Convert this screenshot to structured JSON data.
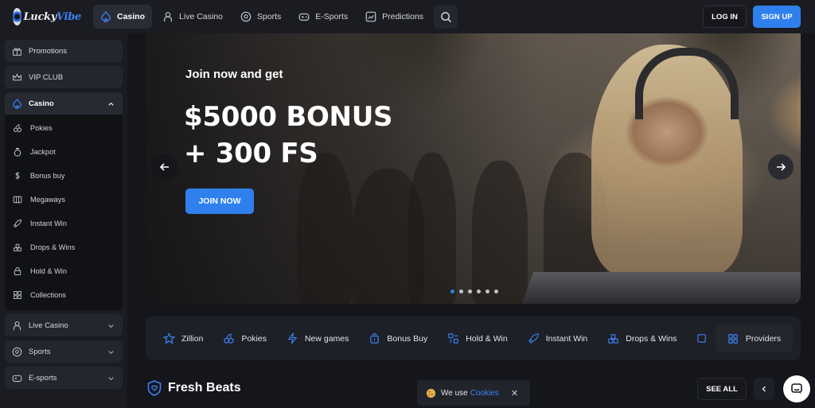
{
  "brand": {
    "logo_part1": "Lucky",
    "logo_part2": "Vibe"
  },
  "nav": {
    "items": [
      {
        "label": "Casino",
        "icon": "spade-icon",
        "active": true
      },
      {
        "label": "Live Casino",
        "icon": "dealer-icon"
      },
      {
        "label": "Sports",
        "icon": "soccer-ball-icon"
      },
      {
        "label": "E-Sports",
        "icon": "gamepad-icon"
      },
      {
        "label": "Predictions",
        "icon": "chart-icon"
      }
    ],
    "search_icon": "search-icon"
  },
  "auth": {
    "login_label": "LOG IN",
    "signup_label": "SIGN UP"
  },
  "sidebar": {
    "top_items": [
      {
        "label": "Promotions",
        "icon": "gift-icon"
      },
      {
        "label": "VIP CLUB",
        "icon": "crown-icon"
      }
    ],
    "casino": {
      "label": "Casino",
      "icon": "spade-icon",
      "expanded": true,
      "sub_items": [
        {
          "label": "Pokies",
          "icon": "cherry-icon"
        },
        {
          "label": "Jackpot",
          "icon": "money-bag-icon"
        },
        {
          "label": "Bonus buy",
          "icon": "dollar-icon"
        },
        {
          "label": "Megaways",
          "icon": "slot-icon"
        },
        {
          "label": "Instant Win",
          "icon": "rocket-icon"
        },
        {
          "label": "Drops & Wins",
          "icon": "drops-icon"
        },
        {
          "label": "Hold & Win",
          "icon": "lock-icon"
        },
        {
          "label": "Collections",
          "icon": "grid-icon"
        }
      ]
    },
    "bottom_items": [
      {
        "label": "Live Casino",
        "icon": "dealer-icon"
      },
      {
        "label": "Sports",
        "icon": "soccer-ball-icon"
      },
      {
        "label": "E-sports",
        "icon": "gamepad-icon"
      }
    ]
  },
  "banner": {
    "subtitle": "Join now and get",
    "title_line1": "$5000 BONUS",
    "title_line2": "+ 300 FS",
    "cta_label": "JOIN NOW",
    "slide_count": 6,
    "active_slide": 1
  },
  "categories": [
    {
      "label": "Zillion",
      "icon": "star-icon"
    },
    {
      "label": "Pokies",
      "icon": "cherry-icon"
    },
    {
      "label": "New games",
      "icon": "lightning-icon"
    },
    {
      "label": "Bonus Buy",
      "icon": "bag-icon"
    },
    {
      "label": "Hold & Win",
      "icon": "lock-grid-icon"
    },
    {
      "label": "Instant Win",
      "icon": "rocket-icon"
    },
    {
      "label": "Drops & Wins",
      "icon": "drops-icon"
    }
  ],
  "providers_label": "Providers",
  "section": {
    "title": "Fresh Beats",
    "see_all_label": "SEE ALL"
  },
  "cookie": {
    "text": "We use",
    "link_text": "Cookies",
    "close": "✕"
  },
  "colors": {
    "accent": "#2f80ed",
    "background": "#15161b",
    "panel": "#1b1c22"
  }
}
